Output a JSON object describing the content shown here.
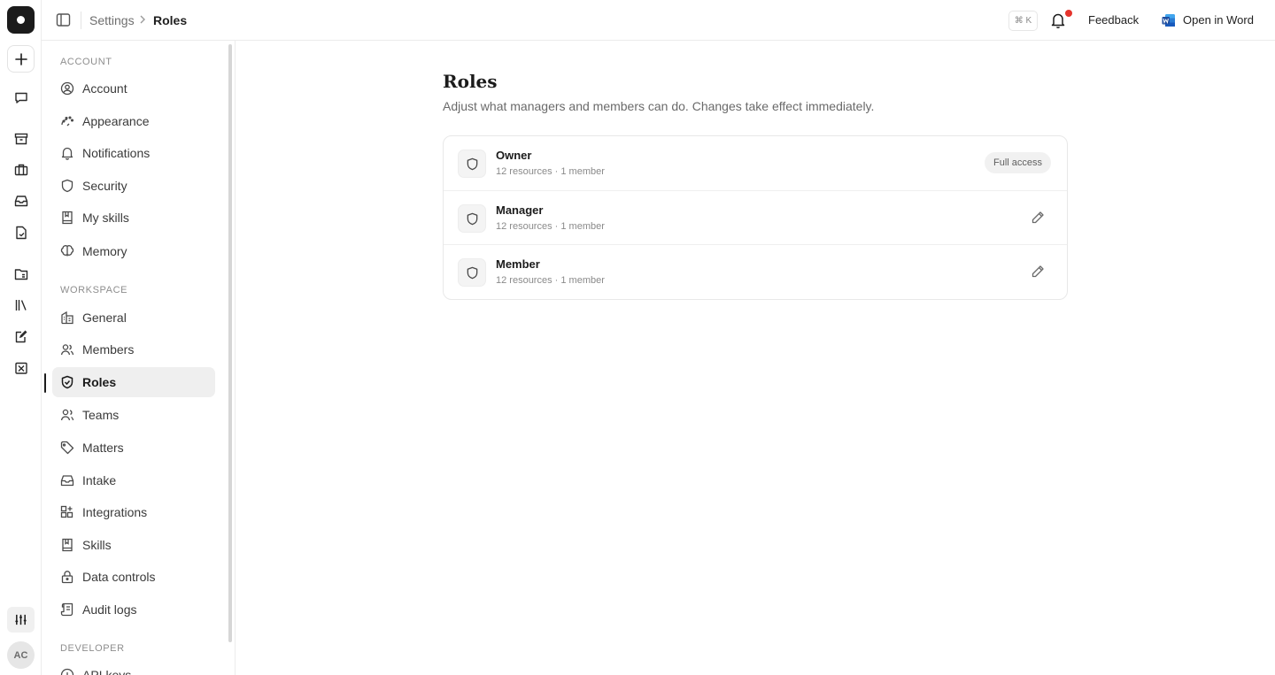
{
  "rail": {
    "logo_icon": "app-logo-icon",
    "new_icon": "plus-icon",
    "items": [
      {
        "icon": "chat-icon"
      },
      {
        "icon": "archive-icon"
      },
      {
        "icon": "briefcase-icon"
      },
      {
        "icon": "inbox-icon"
      },
      {
        "icon": "document-icon"
      },
      {
        "icon": "folder-file-icon"
      },
      {
        "icon": "library-icon"
      },
      {
        "icon": "edit-document-icon"
      },
      {
        "icon": "badge-icon"
      }
    ],
    "settings_icon": "sliders-icon",
    "avatar_initials": "AC"
  },
  "topbar": {
    "breadcrumb_parent": "Settings",
    "breadcrumb_current": "Roles",
    "shortcut_hint": "⌘ K",
    "feedback_label": "Feedback",
    "open_word_label": "Open in Word",
    "notification_dot_color": "#e5342c"
  },
  "sidebar": {
    "sections": [
      {
        "title": "ACCOUNT",
        "items": [
          {
            "label": "Account",
            "icon": "user-circle-icon"
          },
          {
            "label": "Appearance",
            "icon": "palette-icon"
          },
          {
            "label": "Notifications",
            "icon": "bell-icon"
          },
          {
            "label": "Security",
            "icon": "shield-icon"
          },
          {
            "label": "My skills",
            "icon": "book-icon"
          },
          {
            "label": "Memory",
            "icon": "brain-icon"
          }
        ]
      },
      {
        "title": "WORKSPACE",
        "items": [
          {
            "label": "General",
            "icon": "building-icon"
          },
          {
            "label": "Members",
            "icon": "users-icon"
          },
          {
            "label": "Roles",
            "icon": "shield-check-icon",
            "active": true
          },
          {
            "label": "Teams",
            "icon": "team-icon"
          },
          {
            "label": "Matters",
            "icon": "tag-icon"
          },
          {
            "label": "Intake",
            "icon": "inbox-icon"
          },
          {
            "label": "Integrations",
            "icon": "grid-plus-icon"
          },
          {
            "label": "Skills",
            "icon": "book-icon"
          },
          {
            "label": "Data controls",
            "icon": "lock-icon"
          },
          {
            "label": "Audit logs",
            "icon": "scroll-icon"
          }
        ]
      },
      {
        "title": "DEVELOPER",
        "items": [
          {
            "label": "API keys",
            "icon": "key-icon"
          }
        ]
      }
    ]
  },
  "main": {
    "title": "Roles",
    "subtitle": "Adjust what managers and members can do. Changes take effect immediately.",
    "roles": [
      {
        "name": "Owner",
        "meta": "12 resources · 1 member",
        "badge": "Full access"
      },
      {
        "name": "Manager",
        "meta": "12 resources · 1 member",
        "action_icon": "pencil-icon"
      },
      {
        "name": "Member",
        "meta": "12 resources · 1 member",
        "action_icon": "pencil-icon"
      }
    ]
  }
}
